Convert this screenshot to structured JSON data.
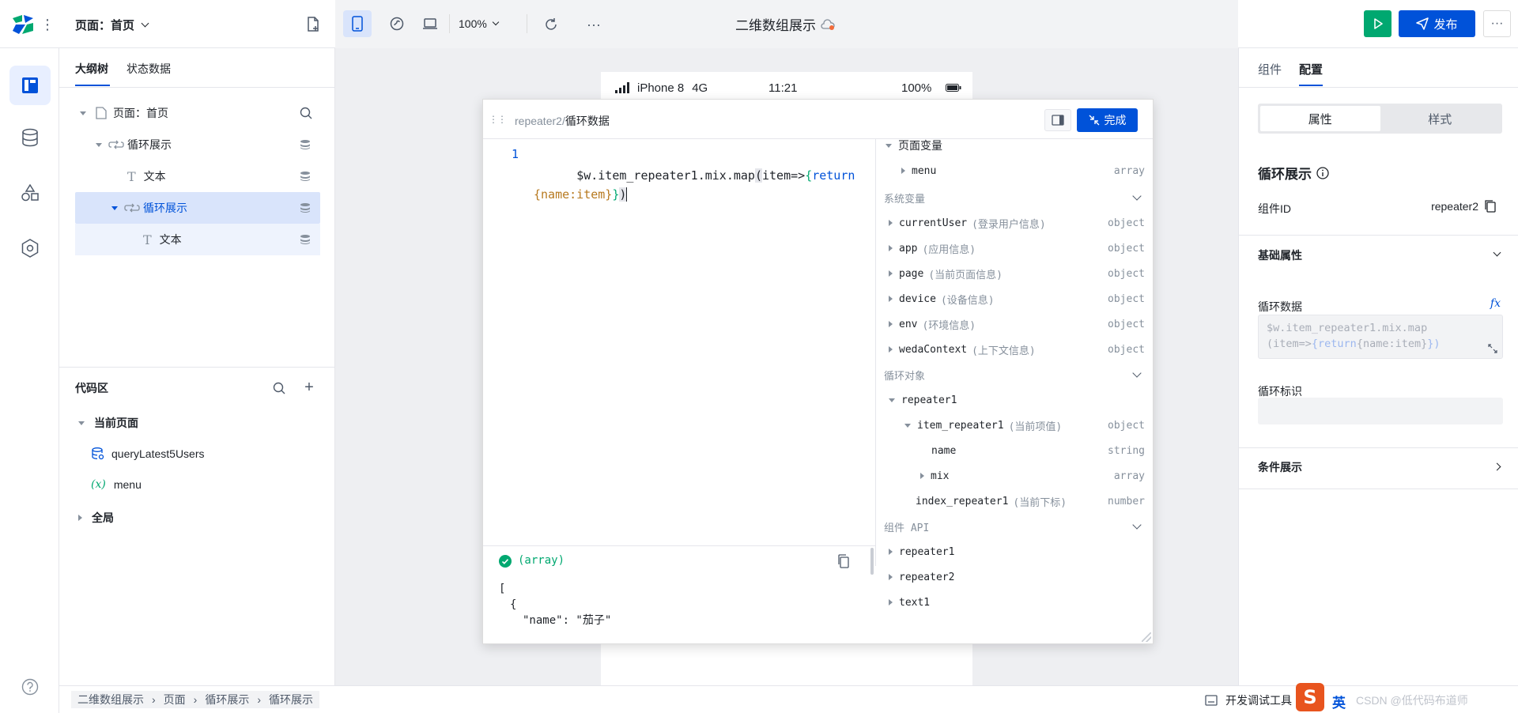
{
  "header": {
    "page_selector": "页面：首页",
    "zoom": "100%",
    "title": "二维数组展示",
    "publish_label": "发布"
  },
  "left_panel": {
    "tabs": [
      "大纲树",
      "状态数据"
    ],
    "tree": [
      {
        "label": "页面：首页"
      },
      {
        "label": "循环展示"
      },
      {
        "label": "文本"
      },
      {
        "label": "循环展示"
      },
      {
        "label": "文本"
      }
    ],
    "code_area": {
      "title": "代码区",
      "current_page": "当前页面",
      "items": [
        "queryLatest5Users",
        "menu"
      ],
      "global": "全局"
    }
  },
  "phone": {
    "device": "iPhone 8",
    "network": "4G",
    "time": "11:21",
    "battery": "100%"
  },
  "editor": {
    "breadcrumb_parent": "repeater2",
    "breadcrumb_sep": "/",
    "breadcrumb_current": "循环数据",
    "done_label": "完成",
    "line_no": "1",
    "code_part1": "$w.item_repeater1.mix.map",
    "code_part2": "(",
    "code_part3": "item=>",
    "code_part4": "{",
    "code_part5": "return",
    "code_part6": "{name:item}",
    "code_part7": "}",
    "code_part8": ")",
    "result_type": "(array)",
    "result_lines": [
      "[",
      "{",
      "\"name\": \"茄子\""
    ]
  },
  "vars": {
    "page_vars": "页面变量",
    "menu": {
      "name": "menu",
      "type": "array"
    },
    "sys_vars": "系统变量",
    "sys_items": [
      {
        "name": "currentUser",
        "comment": "(登录用户信息)",
        "type": "object"
      },
      {
        "name": "app",
        "comment": "(应用信息)",
        "type": "object"
      },
      {
        "name": "page",
        "comment": "(当前页面信息)",
        "type": "object"
      },
      {
        "name": "device",
        "comment": "(设备信息)",
        "type": "object"
      },
      {
        "name": "env",
        "comment": "(环境信息)",
        "type": "object"
      },
      {
        "name": "wedaContext",
        "comment": "(上下文信息)",
        "type": "object"
      }
    ],
    "loop_objs": "循环对象",
    "repeater1": "repeater1",
    "item_repeater1": {
      "name": "item_repeater1",
      "comment": "(当前项值)",
      "type": "object"
    },
    "name_field": {
      "name": "name",
      "type": "string"
    },
    "mix_field": {
      "name": "mix",
      "type": "array"
    },
    "index_repeater1": {
      "name": "index_repeater1",
      "comment": "(当前下标)",
      "type": "number"
    },
    "component_api": "组件 API",
    "api_items": [
      "repeater1",
      "repeater2",
      "text1"
    ]
  },
  "right_panel": {
    "tabs": [
      "组件",
      "配置"
    ],
    "segments": [
      "属性",
      "样式"
    ],
    "component_title": "循环展示",
    "component_id_label": "组件ID",
    "component_id_value": "repeater2",
    "basic_props": "基础属性",
    "loop_data_label": "循环数据",
    "loop_data_value_1": "$w.item_repeater1.mix.map",
    "loop_data_value_2a": "(item=>",
    "loop_data_value_2b": "{return",
    "loop_data_value_2c": "{name:item}",
    "loop_data_value_2d": "})",
    "loop_id_label": "循环标识",
    "condition_label": "条件展示"
  },
  "statusbar": {
    "breadcrumb": [
      "二维数组展示",
      "页面",
      "循环展示",
      "循环展示"
    ],
    "dev_tools": "开发调试工具",
    "ime": "英",
    "watermark": "CSDN @低代码布道师"
  },
  "colors": {
    "primary": "#0052d9",
    "green": "#00a870",
    "selected_bg": "#d9e4fb"
  }
}
